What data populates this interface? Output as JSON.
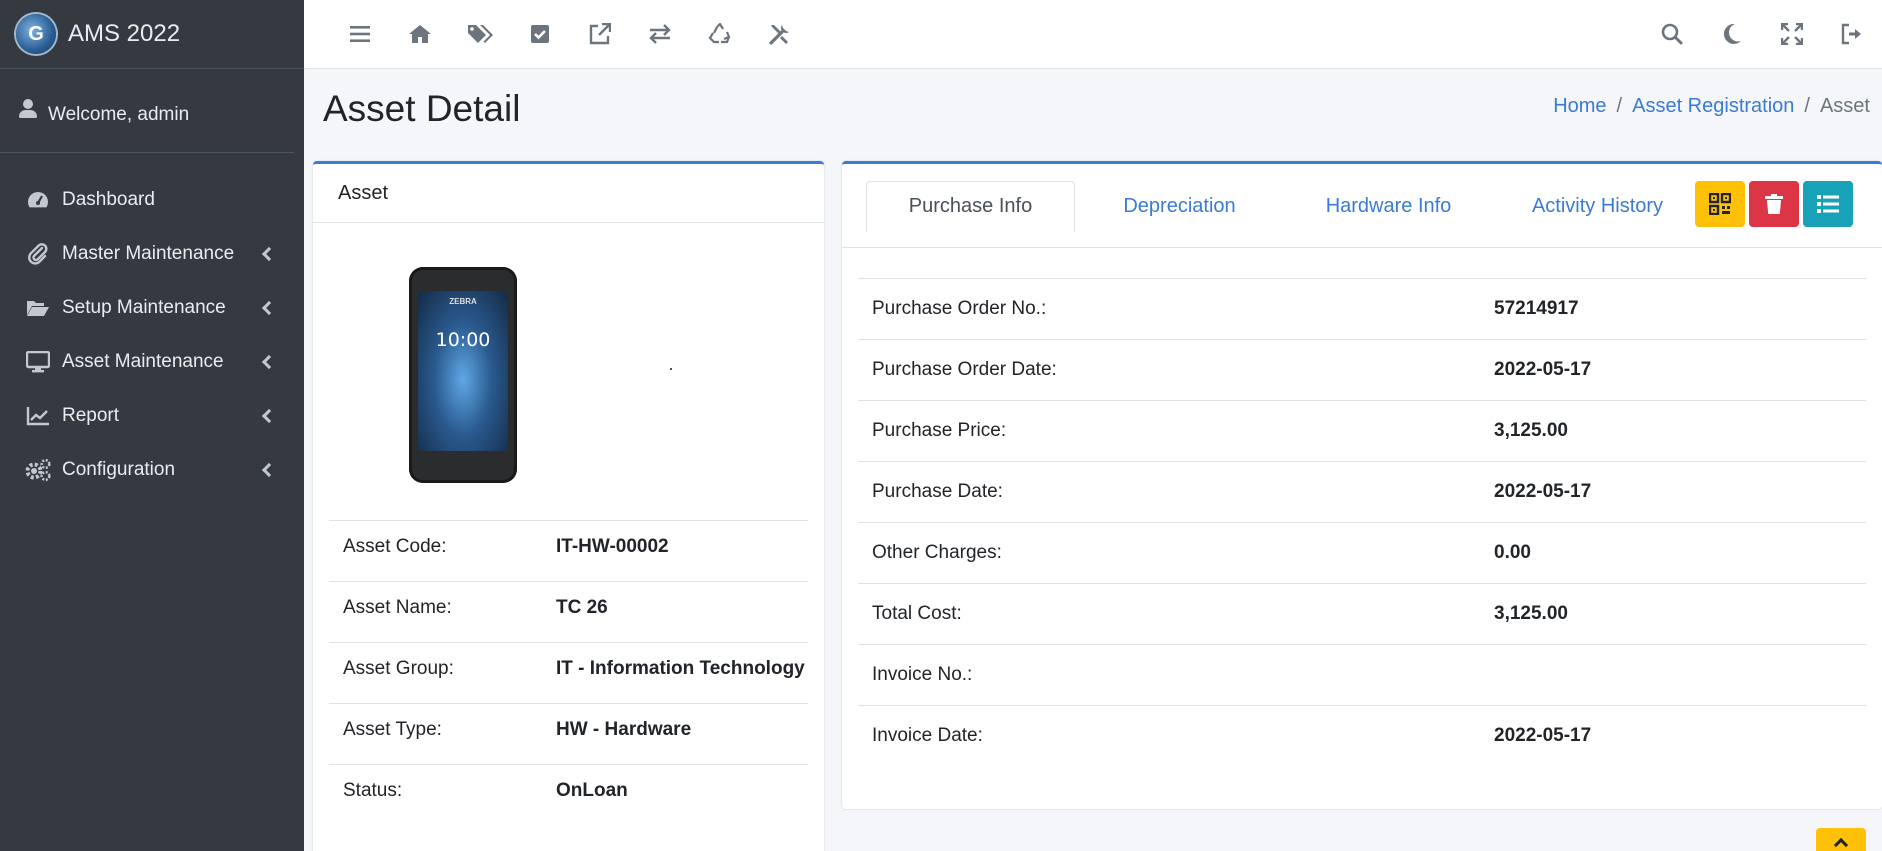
{
  "brand": {
    "title": "AMS 2022",
    "logo_letter": "G"
  },
  "user": {
    "welcome": "Welcome, admin"
  },
  "sidebar": {
    "items": [
      {
        "label": "Dashboard",
        "icon": "tachometer-icon",
        "has_children": false
      },
      {
        "label": "Master Maintenance",
        "icon": "paperclip-icon",
        "has_children": true
      },
      {
        "label": "Setup Maintenance",
        "icon": "folder-open-icon",
        "has_children": true
      },
      {
        "label": "Asset Maintenance",
        "icon": "desktop-icon",
        "has_children": true
      },
      {
        "label": "Report",
        "icon": "chart-line-icon",
        "has_children": true
      },
      {
        "label": "Configuration",
        "icon": "cogs-icon",
        "has_children": true
      }
    ]
  },
  "page": {
    "title": "Asset Detail"
  },
  "breadcrumb": {
    "home": "Home",
    "section": "Asset Registration",
    "current": "Asset"
  },
  "asset_card": {
    "header": "Asset",
    "phone_time": "10:00",
    "phone_brand": "ZEBRA",
    "rows": [
      {
        "label": "Asset Code:",
        "value": "IT-HW-00002"
      },
      {
        "label": "Asset Name:",
        "value": "TC 26"
      },
      {
        "label": "Asset Group:",
        "value": "IT - Information Technology"
      },
      {
        "label": "Asset Type:",
        "value": "HW - Hardware"
      },
      {
        "label": "Status:",
        "value": "OnLoan"
      }
    ]
  },
  "tabs": [
    {
      "label": "Purchase Info",
      "active": true
    },
    {
      "label": "Depreciation",
      "active": false
    },
    {
      "label": "Hardware Info",
      "active": false
    },
    {
      "label": "Activity History",
      "active": false
    }
  ],
  "actions": [
    {
      "name": "qrcode-button",
      "color": "#ffc107"
    },
    {
      "name": "delete-button",
      "color": "#dc3545"
    },
    {
      "name": "list-button",
      "color": "#17a2b8"
    }
  ],
  "purchase_info": {
    "rows": [
      {
        "label": "Purchase Order No.:",
        "value": "57214917"
      },
      {
        "label": "Purchase Order Date:",
        "value": "2022-05-17"
      },
      {
        "label": "Purchase Price:",
        "value": "3,125.00"
      },
      {
        "label": "Purchase Date:",
        "value": "2022-05-17"
      },
      {
        "label": "Other Charges:",
        "value": "0.00"
      },
      {
        "label": "Total Cost:",
        "value": "3,125.00"
      },
      {
        "label": "Invoice No.:",
        "value": ""
      },
      {
        "label": "Invoice Date:",
        "value": "2022-05-17"
      }
    ]
  }
}
